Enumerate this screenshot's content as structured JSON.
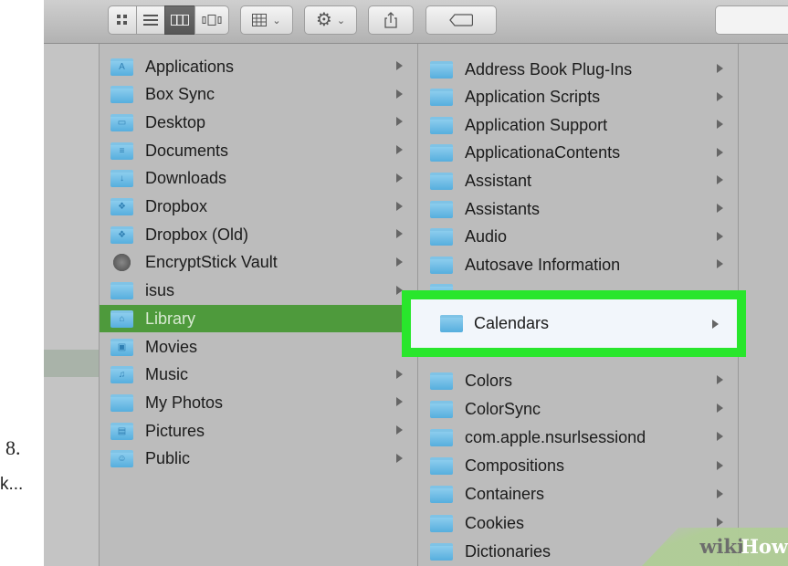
{
  "step_number": "8.",
  "sidebar": {
    "partial_item": "k..."
  },
  "column1": {
    "items": [
      {
        "label": "Applications",
        "icon": "applications-folder-icon",
        "has_arrow": true
      },
      {
        "label": "Box Sync",
        "icon": "folder-icon",
        "has_arrow": true
      },
      {
        "label": "Desktop",
        "icon": "desktop-folder-icon",
        "has_arrow": true
      },
      {
        "label": "Documents",
        "icon": "documents-folder-icon",
        "has_arrow": true
      },
      {
        "label": "Downloads",
        "icon": "downloads-folder-icon",
        "has_arrow": true
      },
      {
        "label": "Dropbox",
        "icon": "dropbox-folder-icon",
        "has_arrow": true
      },
      {
        "label": "Dropbox (Old)",
        "icon": "dropbox-folder-icon",
        "has_arrow": true
      },
      {
        "label": "EncryptStick Vault",
        "icon": "vault-icon",
        "has_arrow": true
      },
      {
        "label": "isus",
        "icon": "folder-icon",
        "has_arrow": true
      },
      {
        "label": "Library",
        "icon": "library-folder-icon",
        "has_arrow": false,
        "selected": true
      },
      {
        "label": "Movies",
        "icon": "movies-folder-icon",
        "has_arrow": false
      },
      {
        "label": "Music",
        "icon": "music-folder-icon",
        "has_arrow": true
      },
      {
        "label": "My Photos",
        "icon": "folder-icon",
        "has_arrow": true
      },
      {
        "label": "Pictures",
        "icon": "pictures-folder-icon",
        "has_arrow": true
      },
      {
        "label": "Public",
        "icon": "public-folder-icon",
        "has_arrow": true
      }
    ]
  },
  "column2": {
    "items_above": [
      {
        "label": "Address Book Plug-Ins",
        "has_arrow": true
      },
      {
        "label": "Application Scripts",
        "has_arrow": true
      },
      {
        "label": "Application Support",
        "has_arrow": true
      },
      {
        "label": "ApplicationaContents",
        "has_arrow": true
      },
      {
        "label": "Assistant",
        "has_arrow": true
      },
      {
        "label": "Assistants",
        "has_arrow": true
      },
      {
        "label": "Audio",
        "has_arrow": true
      },
      {
        "label": "Autosave Information",
        "has_arrow": true
      }
    ],
    "highlighted": {
      "label": "Calendars",
      "has_arrow": true
    },
    "items_below": [
      {
        "label": "Colors",
        "has_arrow": true
      },
      {
        "label": "ColorSync",
        "has_arrow": true
      },
      {
        "label": "com.apple.nsurlsessiond",
        "has_arrow": true
      },
      {
        "label": "Compositions",
        "has_arrow": true
      },
      {
        "label": "Containers",
        "has_arrow": true
      },
      {
        "label": "Cookies",
        "has_arrow": true
      },
      {
        "label": "Dictionaries",
        "has_arrow": false
      }
    ]
  },
  "highlight_color": "#29e62c",
  "selection_color": "#4e9a3c",
  "watermark": {
    "wiki": "wiki",
    "how": "How"
  }
}
